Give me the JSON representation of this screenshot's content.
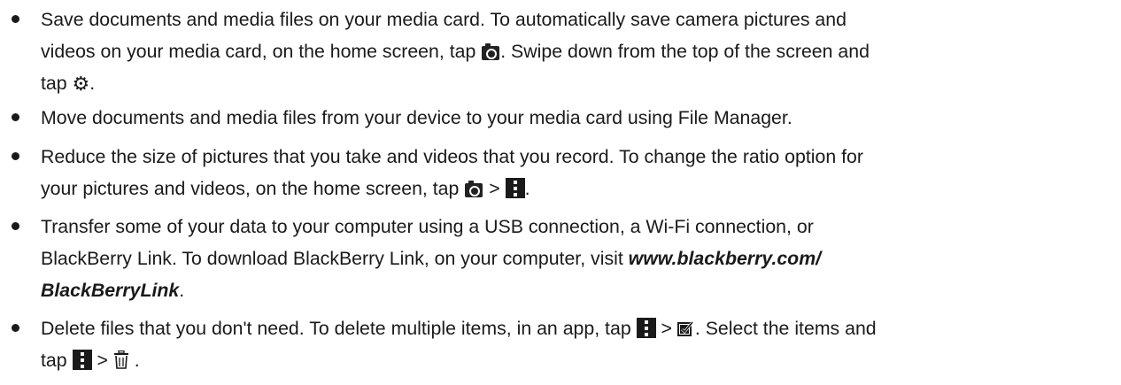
{
  "tips": [
    {
      "lines": [
        [
          "Save documents and media files on your media card. To automatically save camera pictures and"
        ],
        [
          "videos on your media card, on the home screen, tap ",
          "{camera}",
          ". Swipe down from the top of the screen and"
        ],
        [
          "tap ",
          "{gear}",
          "."
        ]
      ]
    },
    {
      "lines": [
        [
          "Move documents and media files from your device to your media card using File Manager."
        ]
      ]
    },
    {
      "lines": [
        [
          "Reduce the size of pictures that you take and videos that you record. To change the ratio option for"
        ],
        [
          "your pictures and videos, on the home screen, tap ",
          "{camera}",
          " > ",
          "{menu}",
          "."
        ]
      ]
    },
    {
      "lines": [
        [
          "Transfer some of your data to your computer using a USB connection, a Wi-Fi connection, or"
        ],
        [
          "BlackBerry Link. To download BlackBerry Link, on your computer, visit ",
          "{url1}"
        ],
        [
          "{url2}",
          "."
        ]
      ]
    },
    {
      "lines": [
        [
          "Delete files that you don't need. To delete multiple items, in an app, tap ",
          "{menu}",
          " > ",
          "{select}",
          ". Select the items and"
        ],
        [
          "tap ",
          "{menu}",
          " > ",
          "{trash}",
          " ."
        ]
      ]
    }
  ],
  "link": {
    "url_line1": "www.blackberry.com/",
    "url_line2": "BlackBerryLink"
  },
  "icons": {
    "camera": "camera-icon",
    "gear": "gear-icon",
    "menu": "menu-icon",
    "select": "select-icon",
    "trash": "trash-icon"
  },
  "colors": {
    "text": "#1a1a1a",
    "background": "#ffffff"
  }
}
